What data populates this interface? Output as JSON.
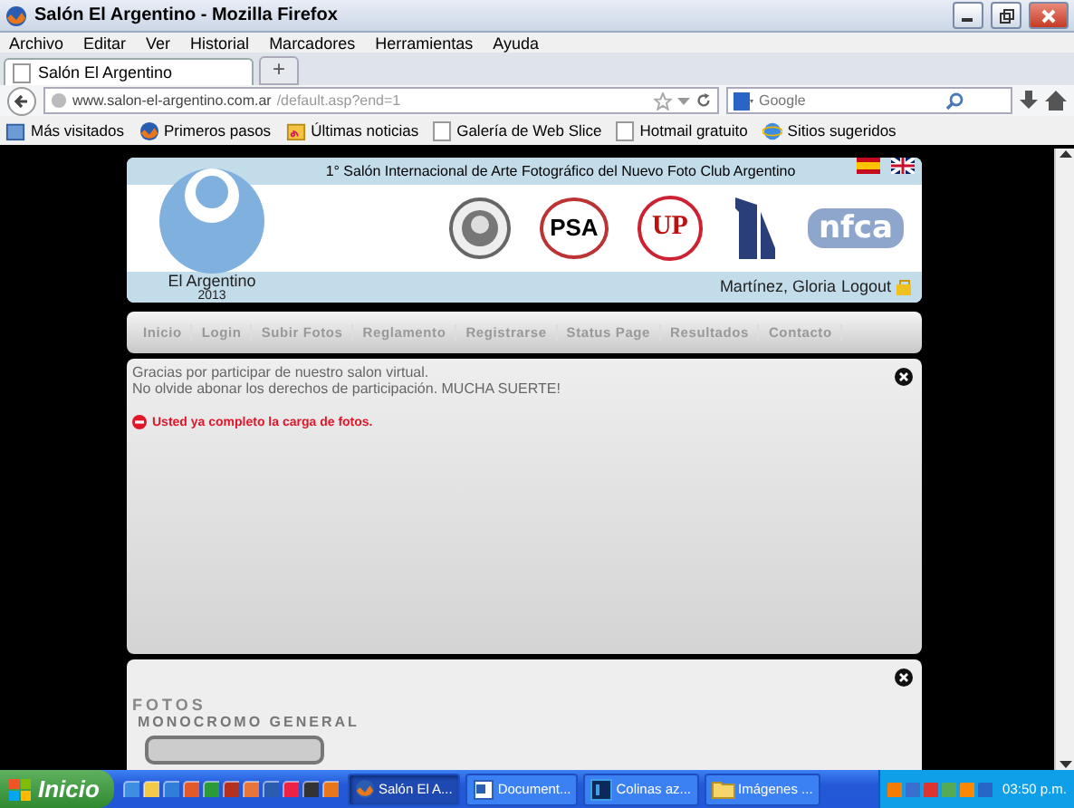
{
  "window": {
    "title": "Salón El Argentino - Mozilla Firefox"
  },
  "menu": [
    "Archivo",
    "Editar",
    "Ver",
    "Historial",
    "Marcadores",
    "Herramientas",
    "Ayuda"
  ],
  "tabs": [
    {
      "label": "Salón El Argentino",
      "selected": true
    }
  ],
  "new_tab": "+",
  "address": {
    "domain": "www.salon-el-argentino.com.ar",
    "path": "/default.asp?end=1"
  },
  "search": {
    "placeholder": "Google"
  },
  "bookmarks": [
    {
      "label": "Más visitados",
      "kind": "blue"
    },
    {
      "label": "Primeros pasos",
      "kind": "fox"
    },
    {
      "label": "Últimas noticias",
      "kind": "feed"
    },
    {
      "label": "Galería de Web Slice",
      "kind": "page"
    },
    {
      "label": "Hotmail gratuito",
      "kind": "page"
    },
    {
      "label": "Sitios sugeridos",
      "kind": "ie"
    }
  ],
  "site": {
    "banner": "1° Salón Internacional de Arte Fotográfico del Nuevo Foto Club Argentino",
    "logo_name": "El Argentino",
    "logo_year": "2013",
    "user": "Martínez, Gloria",
    "logout": "Logout",
    "logos": [
      {
        "kind": "seal"
      },
      {
        "kind": "psa",
        "text": "PSA"
      },
      {
        "kind": "up",
        "text": "UP"
      },
      {
        "kind": "pillar"
      },
      {
        "kind": "nfca",
        "text": "nfca"
      }
    ]
  },
  "nav": [
    "Inicio",
    "Login",
    "Subir Fotos",
    "Reglamento",
    "Registrarse",
    "Status Page",
    "Resultados",
    "Contacto"
  ],
  "messages": {
    "lines": [
      "Gracias por participar de nuestro salon virtual.",
      "No olvide abonar los derechos de participación. MUCHA SUERTE!"
    ],
    "alert": "Usted ya completo la carga de fotos."
  },
  "photos": {
    "title": "FOTOS",
    "category": "MONOCROMO GENERAL"
  },
  "taskbar": {
    "start": "Inicio",
    "tasks": [
      {
        "label": "Salón El A...",
        "kind": "fox",
        "selected": true
      },
      {
        "label": "Document...",
        "kind": "doc",
        "selected": false
      },
      {
        "label": "Colinas az...",
        "kind": "ps",
        "selected": false
      },
      {
        "label": "Imágenes ...",
        "kind": "folder",
        "selected": false
      }
    ],
    "clock": "03:50 p.m."
  }
}
